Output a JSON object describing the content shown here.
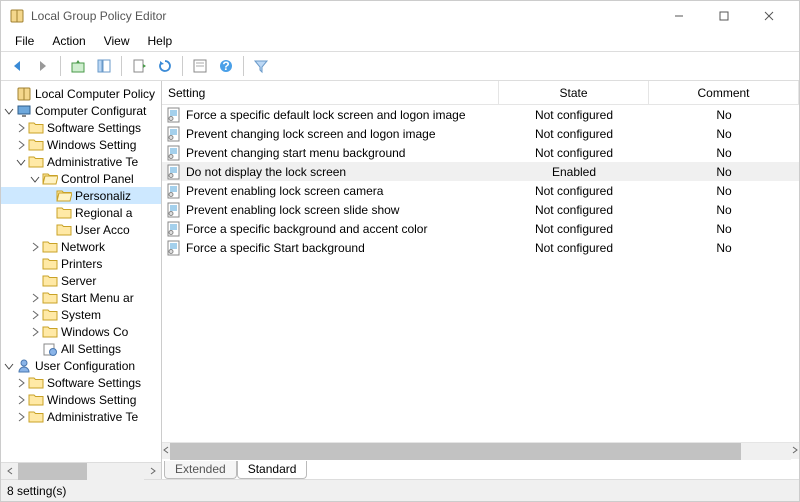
{
  "window": {
    "title": "Local Group Policy Editor"
  },
  "menu": {
    "file": "File",
    "action": "Action",
    "view": "View",
    "help": "Help"
  },
  "tree": {
    "root": "Local Computer Policy",
    "comp_config": "Computer Configurat",
    "soft_settings": "Software Settings",
    "win_settings": "Windows Setting",
    "admin_templates": "Administrative Te",
    "control_panel": "Control Panel",
    "personalization": "Personaliz",
    "regional": "Regional a",
    "user_acco": "User Acco",
    "network": "Network",
    "printers": "Printers",
    "server": "Server",
    "start_menu": "Start Menu ar",
    "system": "System",
    "windows_co": "Windows Co",
    "all_settings": "All Settings",
    "user_config": "User Configuration",
    "u_soft_settings": "Software Settings",
    "u_win_settings": "Windows Setting",
    "u_admin_templates": "Administrative Te"
  },
  "columns": {
    "setting": "Setting",
    "state": "State",
    "comment": "Comment"
  },
  "settings": [
    {
      "name": "Force a specific default lock screen and logon image",
      "state": "Not configured",
      "comment": "No"
    },
    {
      "name": "Prevent changing lock screen and logon image",
      "state": "Not configured",
      "comment": "No"
    },
    {
      "name": "Prevent changing start menu background",
      "state": "Not configured",
      "comment": "No"
    },
    {
      "name": "Do not display the lock screen",
      "state": "Enabled",
      "comment": "No",
      "selected": true
    },
    {
      "name": "Prevent enabling lock screen camera",
      "state": "Not configured",
      "comment": "No"
    },
    {
      "name": "Prevent enabling lock screen slide show",
      "state": "Not configured",
      "comment": "No"
    },
    {
      "name": "Force a specific background and accent color",
      "state": "Not configured",
      "comment": "No"
    },
    {
      "name": "Force a specific Start background",
      "state": "Not configured",
      "comment": "No"
    }
  ],
  "tabs": {
    "extended": "Extended",
    "standard": "Standard"
  },
  "status": "8 setting(s)"
}
